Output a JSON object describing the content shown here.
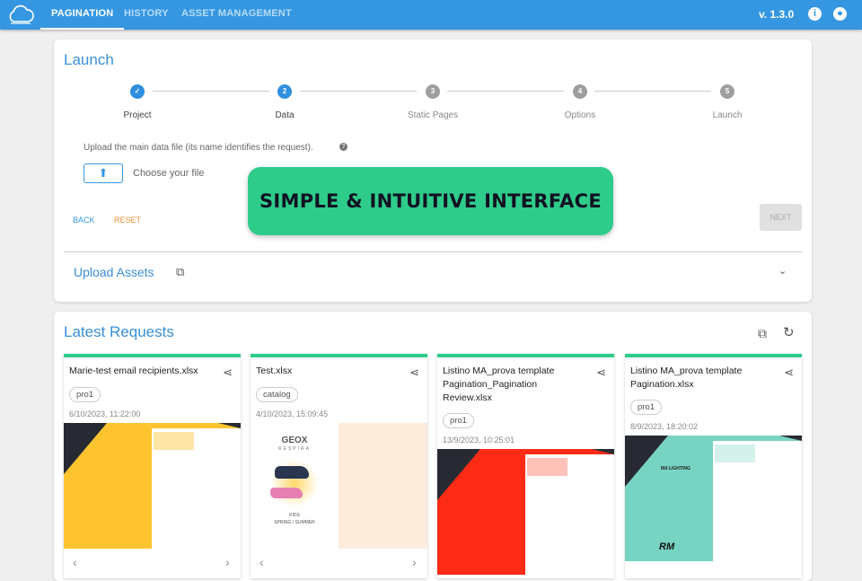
{
  "nav": {
    "tabs": [
      "PAGINATION",
      "HISTORY",
      "ASSET MANAGEMENT"
    ],
    "version": "v. 1.3.0",
    "info_icon": "info-icon",
    "account_icon": "account-circle-icon"
  },
  "launch": {
    "title": "Launch",
    "steps": [
      {
        "n": "✓",
        "label": "Project"
      },
      {
        "n": "2",
        "label": "Data"
      },
      {
        "n": "3",
        "label": "Static Pages"
      },
      {
        "n": "4",
        "label": "Options"
      },
      {
        "n": "5",
        "label": "Launch"
      }
    ],
    "upload_hint": "Upload the main data file (its name identifies the request).",
    "help": "?",
    "choose": "Choose your file",
    "back": "BACK",
    "reset": "RESET",
    "next": "NEXT"
  },
  "assets": {
    "title": "Upload Assets"
  },
  "banner": "SIMPLE & INTUITIVE INTERFACE",
  "latest": {
    "title": "Latest Requests",
    "cards": [
      {
        "title": "Marie-test email recipients.xlsx",
        "tag": "pro1",
        "date": "6/10/2023, 11:22:00"
      },
      {
        "title": "Test.xlsx",
        "tag": "catalog",
        "date": "4/10/2023, 15:09:45",
        "brand": "GEOX",
        "sub": "RESPIRA",
        "kids": "KIDS",
        "season": "SPRING / SUMMER"
      },
      {
        "title": "Listino MA_prova template Pagination_Pagination Review.xlsx",
        "tag": "pro1",
        "date": "13/9/2023, 10:25:01"
      },
      {
        "title": "Listino MA_prova template Pagination.xlsx",
        "tag": "pro1",
        "date": "8/9/2023, 18:20:02",
        "brand": "RM",
        "ml": "MA LIGHTING"
      }
    ]
  },
  "colors": {
    "primary": "#3597e2",
    "accent": "#2ecc8a"
  }
}
